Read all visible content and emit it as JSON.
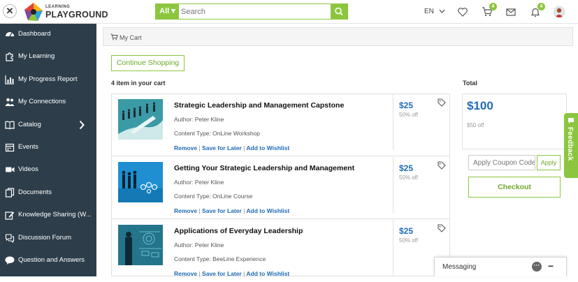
{
  "topbar": {
    "logo_small": "LEARNING",
    "logo_big": "PLAYGROUND",
    "search_category": "All",
    "search_placeholder": "Search",
    "language": "EN",
    "cart_badge": "4",
    "notification_badge": "4"
  },
  "sidebar": {
    "items": [
      {
        "label": "Dashboard",
        "icon": "dashboard-icon"
      },
      {
        "label": "My Learning",
        "icon": "puzzle-icon"
      },
      {
        "label": "My Progress Report",
        "icon": "bar-chart-icon"
      },
      {
        "label": "My Connections",
        "icon": "users-icon"
      },
      {
        "label": "Catalog",
        "icon": "book-icon"
      },
      {
        "label": "Events",
        "icon": "calendar-icon"
      },
      {
        "label": "Videos",
        "icon": "video-icon"
      },
      {
        "label": "Documents",
        "icon": "documents-icon"
      },
      {
        "label": "Knowledge Sharing (W...",
        "icon": "edit-icon"
      },
      {
        "label": "Discussion Forum",
        "icon": "forum-icon"
      },
      {
        "label": "Question and Answers",
        "icon": "chat-icon"
      }
    ]
  },
  "breadcrumb": "My Cart",
  "continue_label": "Continue Shopping",
  "cart_count": "4 item in your cart",
  "items": [
    {
      "title": "Strategic Leadership and Management Capstone",
      "author": "Author: Peter Kline",
      "content_type": "Content Type: OnLine Workshop",
      "price": "$25",
      "discount": "50% off"
    },
    {
      "title": "Getting Your Strategic Leadership and Management",
      "author": "Author: Peter Kline",
      "content_type": "Content Type: OnLine Course",
      "price": "$25",
      "discount": "50% off"
    },
    {
      "title": "Applications of Everyday Leadership",
      "author": "Author: Peter Kline",
      "content_type": "Content Type: BeeLine Experience",
      "price": "$25",
      "discount": "50% off"
    }
  ],
  "item_actions": {
    "remove": "Remove",
    "save": "Save for Later",
    "wishlist": "Add to Wishlist",
    "separator": "|"
  },
  "summary": {
    "total_label": "Total",
    "total": "$100",
    "savings": "$50 off",
    "coupon_placeholder": "Apply Coupon Code",
    "apply_label": "Apply",
    "checkout_label": "Checkout"
  },
  "feedback_label": "Feedback",
  "messaging_label": "Messaging",
  "colors": {
    "accent": "#8cc63f",
    "sidebar": "#2d3e4a",
    "link": "#1e6bb8"
  }
}
